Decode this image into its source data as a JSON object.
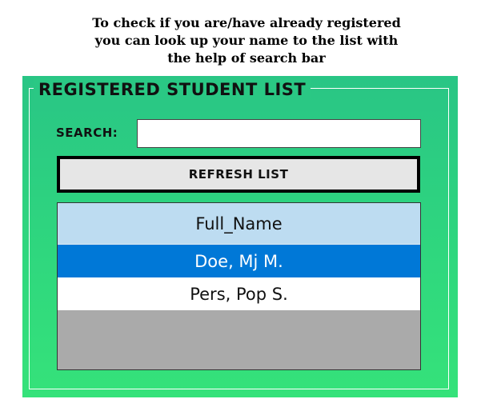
{
  "intro": {
    "line1": "To check if you are/have already registered",
    "line2": "you can look up your name to the list with",
    "line3": "the help of search bar"
  },
  "panel": {
    "title": "REGISTERED STUDENT LIST",
    "search_label": "SEARCH:",
    "search_value": "",
    "refresh_label": "REFRESH LIST"
  },
  "list": {
    "header": "Full_Name",
    "rows": [
      {
        "name": "Doe, Mj M.",
        "selected": true
      },
      {
        "name": "Pers, Pop S.",
        "selected": false
      }
    ]
  },
  "colors": {
    "panel_green": "#2fd77e",
    "selected_row": "#0078d7",
    "header_row": "#bddcf1",
    "empty_area": "#aaaaaa"
  }
}
